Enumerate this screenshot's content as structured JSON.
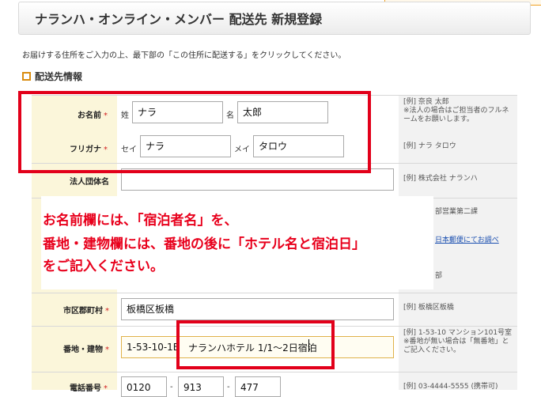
{
  "header": {
    "title": "ナランハ・オンライン・メンバー 配送先 新規登録"
  },
  "instruction": "お届けする住所をご入力の上、最下部の「この住所に配送する」をクリックしてください。",
  "section": {
    "title": "配送先情報"
  },
  "required_mark": "*",
  "form": {
    "name": {
      "label": "お名前",
      "sei_label": "姓",
      "sei_value": "ナラ",
      "mei_label": "名",
      "mei_value": "太郎",
      "example": "[例] 奈良 太郎\n※法人の場合はご担当者のフルネームをお願いします。"
    },
    "kana": {
      "label": "フリガナ",
      "sei_label": "セイ",
      "sei_value": "ナラ",
      "mei_label": "メイ",
      "mei_value": "タロウ",
      "example": "[例] ナラ タロウ"
    },
    "company": {
      "label": "法人団体名",
      "value": "",
      "example": "[例] 株式会社 ナランハ"
    },
    "partial": {
      "dept_example": "部営業第二課",
      "postal_link": "日本郵便にてお調べ",
      "pref_example": "部"
    },
    "city": {
      "label": "市区郡町村",
      "value": "板橋区板橋",
      "example": "[例] 板橋区板橋"
    },
    "address": {
      "label": "番地・建物",
      "value_prefix": "1-53-10-1E",
      "value_highlight": "ナランハホテル 1/1〜2日宿泊",
      "example": "[例] 1-53-10 マンション101号室\n※番地が無い場合は「無番地」とご記入ください。"
    },
    "phone": {
      "label": "電話番号",
      "part1": "0120",
      "part2": "913",
      "part3": "477",
      "separator": "-",
      "example": "[例] 03-4444-5555 (携帯可)"
    }
  },
  "overlay": {
    "line1": "お名前欄には、「宿泊者名」を、",
    "line2": "番地・建物欄には、番地の後に「ホテル名と宿泊日」",
    "line3": "をご記入ください。"
  },
  "colors": {
    "accent_red": "#e2001a",
    "label_bg": "#fbf6da",
    "section_icon": "#d98c10"
  }
}
